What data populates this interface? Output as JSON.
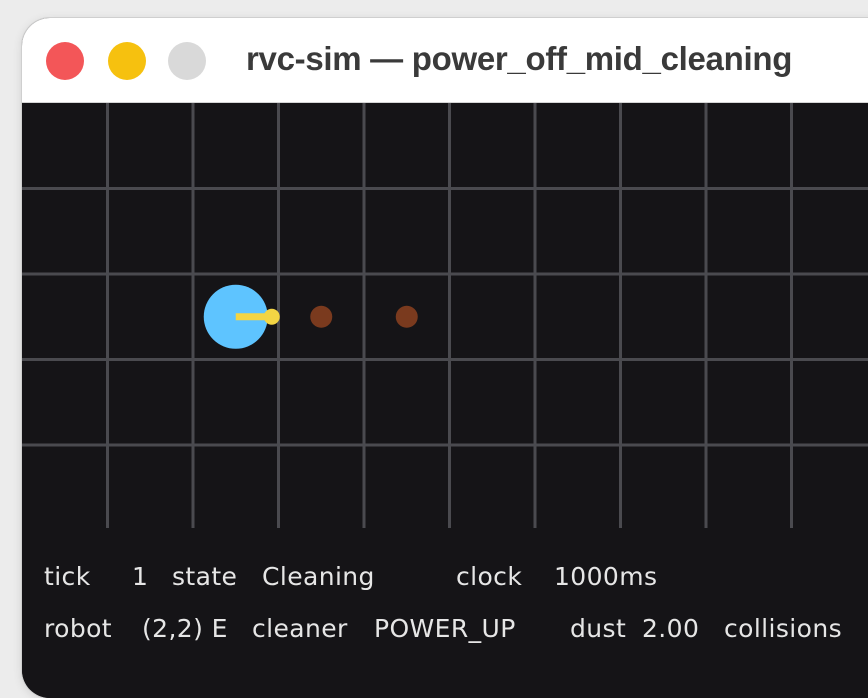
{
  "window": {
    "title": "rvc-sim — power_off_mid_cleaning"
  },
  "simulation": {
    "grid": {
      "cols": 10,
      "rows": 5
    },
    "robot": {
      "col": 2,
      "row": 2,
      "heading": "E",
      "color": "#5ec4ff",
      "arrow_color": "#f3d544"
    },
    "dust": [
      {
        "col": 3,
        "row": 2
      },
      {
        "col": 4,
        "row": 2
      }
    ],
    "colors": {
      "background": "#151417",
      "grid_line": "#4a4a4f",
      "dust": "#7a3a1e"
    }
  },
  "status": {
    "line1": {
      "tick_label": "tick",
      "tick_value": "1",
      "state_label": "state",
      "state_value": "Cleaning",
      "clock_label": "clock",
      "clock_value": "1000ms"
    },
    "line2": {
      "robot_label": "robot",
      "robot_value": "(2,2) E",
      "cleaner_label": "cleaner",
      "cleaner_value": "POWER_UP",
      "dust_label": "dust",
      "dust_value": "2.00",
      "collision_label": "collisions"
    }
  }
}
